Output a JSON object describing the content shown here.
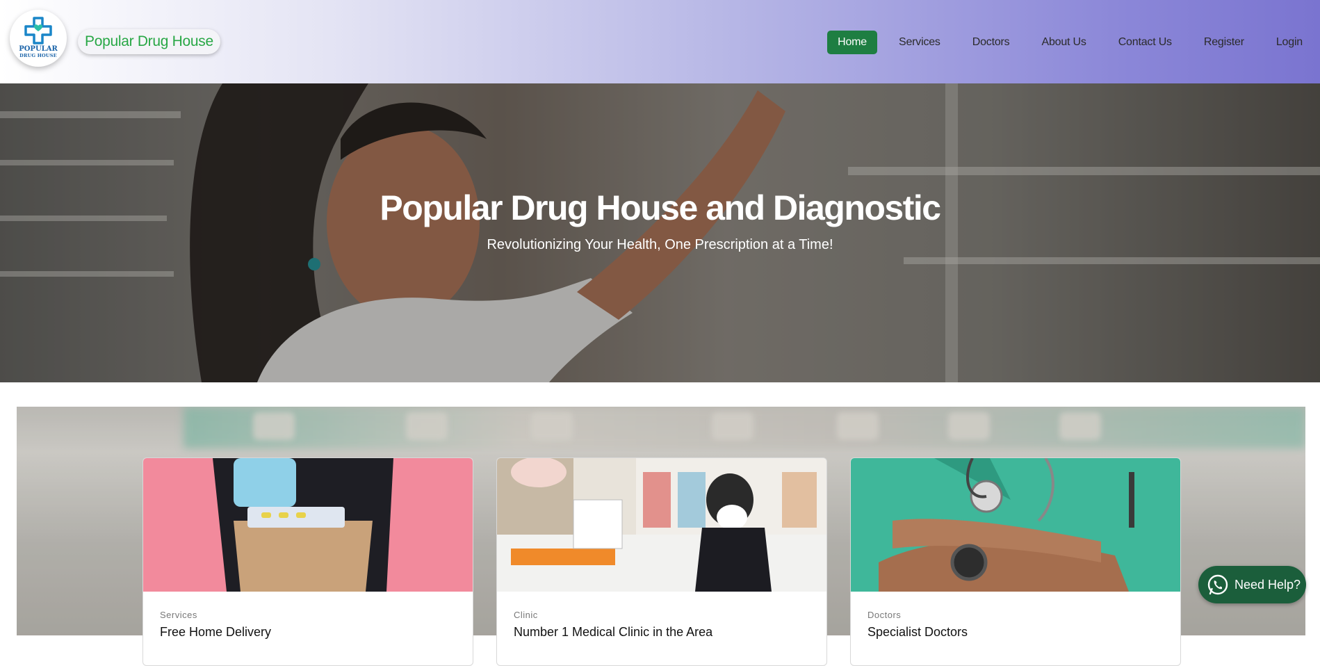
{
  "brand": {
    "logo_line1": "POPULAR",
    "logo_line2": "DRUG HOUSE",
    "name": "Popular Drug House"
  },
  "nav": {
    "items": [
      {
        "label": "Home",
        "active": true
      },
      {
        "label": "Services"
      },
      {
        "label": "Doctors"
      },
      {
        "label": "About Us"
      },
      {
        "label": "Contact Us"
      },
      {
        "label": "Register"
      },
      {
        "label": "Login"
      }
    ]
  },
  "hero": {
    "title": "Popular Drug House and Diagnostic",
    "subtitle": "Revolutionizing Your Health, One Prescription at a Time!"
  },
  "cards": [
    {
      "category": "Services",
      "title": "Free Home Delivery"
    },
    {
      "category": "Clinic",
      "title": "Number 1 Medical Clinic in the Area"
    },
    {
      "category": "Doctors",
      "title": "Specialist Doctors"
    }
  ],
  "help": {
    "label": "Need Help?"
  },
  "colors": {
    "primary_green": "#1e7e42",
    "brand_green": "#28a745",
    "logo_blue": "#1a63a8",
    "whatsapp_green": "#1b5e3b"
  },
  "icons": {
    "logo": "medical-cross-heart-icon",
    "help": "whatsapp-icon"
  }
}
